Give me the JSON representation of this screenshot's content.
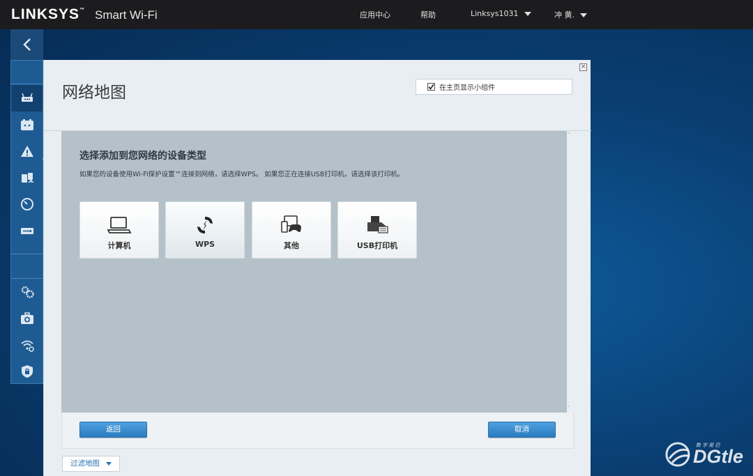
{
  "header": {
    "brand": "LINKSYS",
    "brand_mark": "™",
    "product": "Smart Wi-Fi",
    "links": {
      "app_center": "应用中心",
      "help": "帮助",
      "router_name": "Linksys1031",
      "user_name": "冲 黄."
    }
  },
  "sidebar": {
    "back_icon": "chevron-left-icon",
    "items": [
      {
        "name": "network-map",
        "icon": "network-map-icon",
        "active": true
      },
      {
        "name": "guest-access",
        "icon": "guest-access-icon"
      },
      {
        "name": "parental-controls",
        "icon": "parental-controls-icon"
      },
      {
        "name": "media-prioritization",
        "icon": "media-prioritization-icon"
      },
      {
        "name": "speed-test",
        "icon": "speed-test-icon"
      },
      {
        "name": "usb-storage",
        "icon": "usb-storage-icon"
      },
      {
        "name": "connectivity",
        "icon": "gears-icon"
      },
      {
        "name": "troubleshooting",
        "icon": "first-aid-icon"
      },
      {
        "name": "wireless",
        "icon": "wireless-icon"
      },
      {
        "name": "security",
        "icon": "shield-lock-icon"
      }
    ]
  },
  "modal": {
    "title": "网络地图",
    "close_symbol": "×",
    "show_widget_label": "在主页显示小组件",
    "show_widget_checked": true,
    "section_heading": "选择添加到您网络的设备类型",
    "section_description": "如果您的设备使用Wi-Fi保护设置™连接到网络，请选择WPS。 如果您正在连接USB打印机，请选择该打印机。",
    "devices": [
      {
        "label": "计算机",
        "icon": "laptop-icon"
      },
      {
        "label": "WPS",
        "icon": "wps-icon",
        "selected": true
      },
      {
        "label": "其他",
        "icon": "other-devices-icon"
      },
      {
        "label": "USB打印机",
        "icon": "printer-icon"
      }
    ],
    "back_button": "返回",
    "cancel_button": "取消",
    "filter_button": "过滤地图"
  },
  "watermark": {
    "text": "DGtle",
    "subtext": "数 字 尾 巴"
  },
  "colors": {
    "accent": "#2a7cc0",
    "sidebar_bg": "#1e5b92",
    "topbar_bg": "#1c1c1e"
  }
}
